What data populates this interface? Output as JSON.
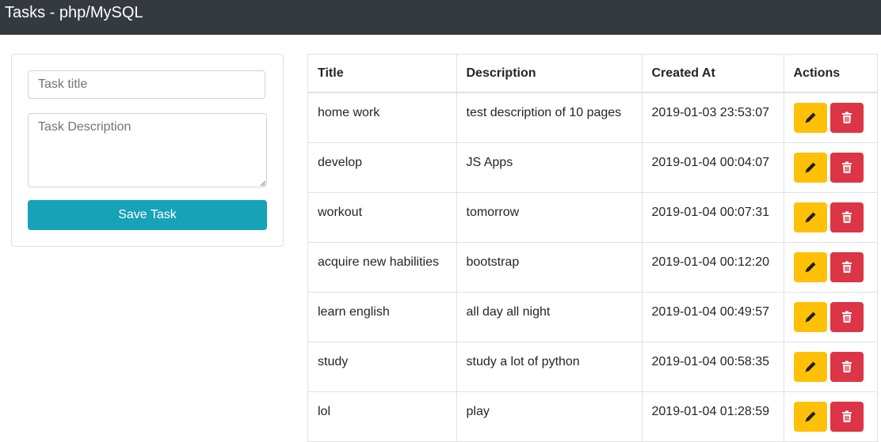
{
  "navbar": {
    "brand": "Tasks - php/MySQL"
  },
  "form": {
    "title_placeholder": "Task title",
    "description_placeholder": "Task Description",
    "save_label": "Save Task"
  },
  "table": {
    "headers": [
      "Title",
      "Description",
      "Created At",
      "Actions"
    ],
    "rows": [
      {
        "title": "home work",
        "description": "test description of 10 pages",
        "created_at": "2019-01-03 23:53:07"
      },
      {
        "title": "develop",
        "description": "JS Apps",
        "created_at": "2019-01-04 00:04:07"
      },
      {
        "title": "workout",
        "description": "tomorrow",
        "created_at": "2019-01-04 00:07:31"
      },
      {
        "title": "acquire new habilities",
        "description": "bootstrap",
        "created_at": "2019-01-04 00:12:20"
      },
      {
        "title": "learn english",
        "description": "all day all night",
        "created_at": "2019-01-04 00:49:57"
      },
      {
        "title": "study",
        "description": "study a lot of python",
        "created_at": "2019-01-04 00:58:35"
      },
      {
        "title": "lol",
        "description": "play",
        "created_at": "2019-01-04 01:28:59"
      }
    ],
    "row_actions": {
      "edit_icon": "pencil-icon",
      "delete_icon": "trash-icon"
    }
  },
  "colors": {
    "navbar": "#343a40",
    "save_button": "#17a2b8",
    "edit_button": "#ffc107",
    "delete_button": "#dc3545"
  }
}
